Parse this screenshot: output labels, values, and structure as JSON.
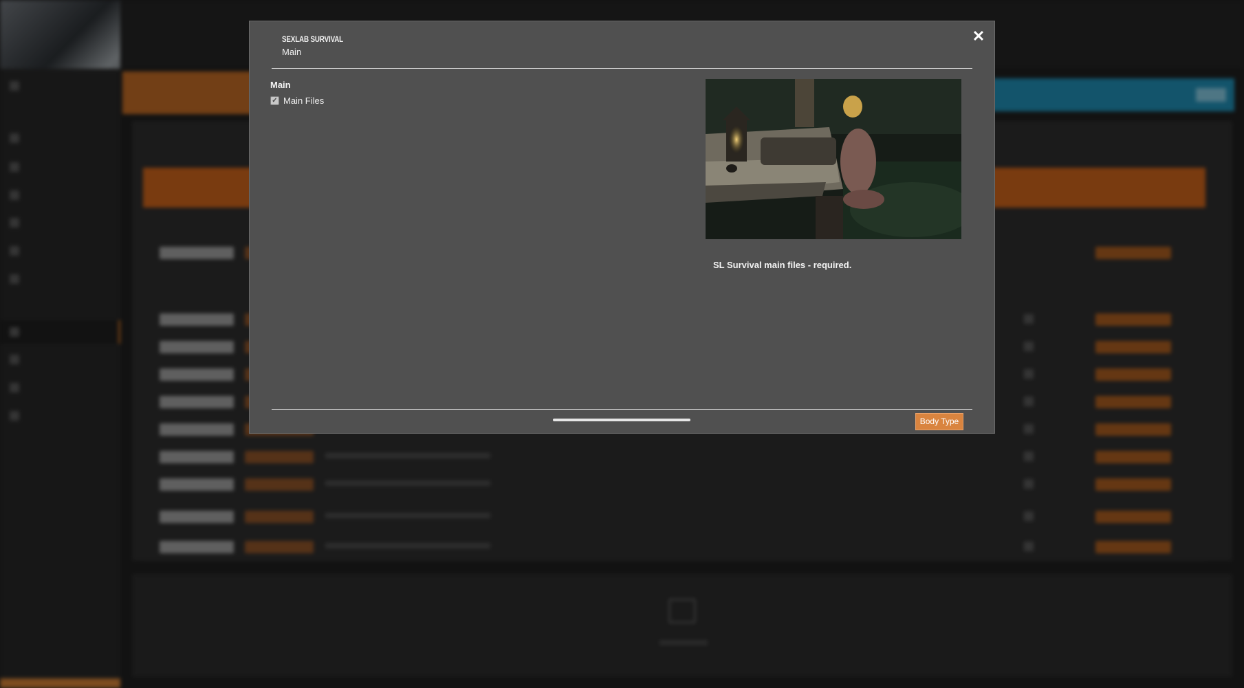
{
  "dialog": {
    "title": "SEXLAB SURVIVAL",
    "step": "Main",
    "close_icon": "close-icon",
    "group": {
      "label": "Main",
      "options": [
        {
          "label": "Main Files",
          "checked": true
        }
      ]
    },
    "preview": {
      "description": "SL Survival main files - required."
    },
    "footer": {
      "next_label": "Body Type"
    }
  },
  "colors": {
    "accent": "#d9843f",
    "modal_bg": "#505050",
    "background": "#1e1e1e"
  }
}
